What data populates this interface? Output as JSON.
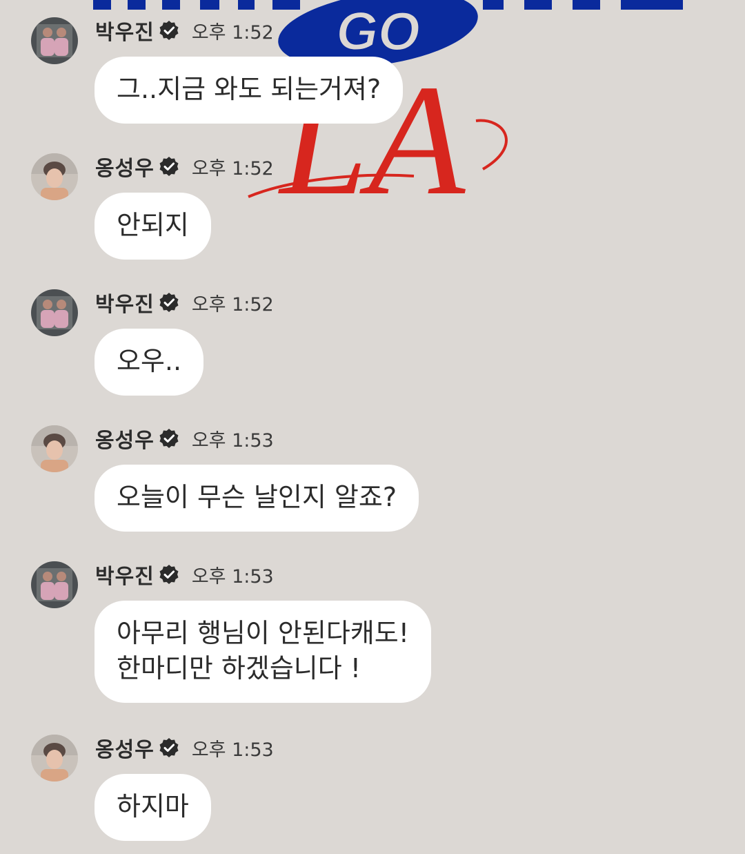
{
  "background": {
    "color": "#dcd8d4",
    "logo_main_text": "GO",
    "logo_script_text": "LA",
    "logo_blue": "#0a2a9c",
    "logo_red": "#d7261e"
  },
  "messages": [
    {
      "sender": "박우진",
      "avatar_icon": "avatar-park-woojin",
      "verified_icon": "verified-check-icon",
      "time": "오후 1:52",
      "text": "그..지금 와도 되는거져?"
    },
    {
      "sender": "옹성우",
      "avatar_icon": "avatar-ong-seongwoo",
      "verified_icon": "verified-check-icon",
      "time": "오후 1:52",
      "text": "안되지"
    },
    {
      "sender": "박우진",
      "avatar_icon": "avatar-park-woojin",
      "verified_icon": "verified-check-icon",
      "time": "오후 1:52",
      "text": "오우.."
    },
    {
      "sender": "옹성우",
      "avatar_icon": "avatar-ong-seongwoo",
      "verified_icon": "verified-check-icon",
      "time": "오후 1:53",
      "text": "오늘이 무슨 날인지 알죠?"
    },
    {
      "sender": "박우진",
      "avatar_icon": "avatar-park-woojin",
      "verified_icon": "verified-check-icon",
      "time": "오후 1:53",
      "text": "아무리 행님이 안된다캐도!\n한마디만 하겠습니다 !"
    },
    {
      "sender": "옹성우",
      "avatar_icon": "avatar-ong-seongwoo",
      "verified_icon": "verified-check-icon",
      "time": "오후 1:53",
      "text": "하지마"
    }
  ]
}
